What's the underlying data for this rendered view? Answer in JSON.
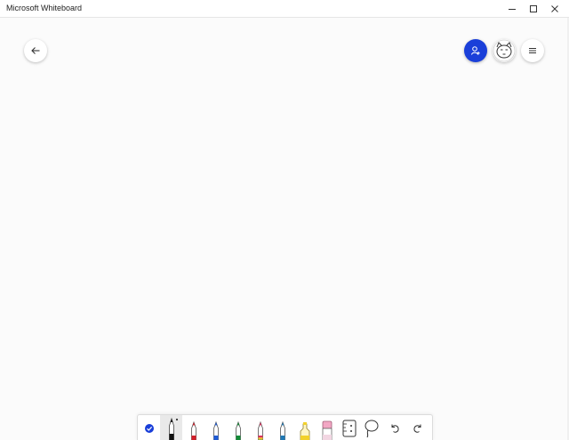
{
  "window": {
    "title": "Microsoft Whiteboard"
  },
  "colors": {
    "accent": "#1a3fd9",
    "pen_black": "#111111",
    "pen_red": "#d21f2a",
    "pen_blue": "#1e5bd6",
    "pen_green": "#138a36",
    "pen_pink": "#d9335e",
    "pen_teal": "#1f78b4",
    "highlighter_yellow": "#f2d12a",
    "eraser_pink": "#f2a7c4"
  },
  "header": {
    "back_icon": "arrow-left-icon",
    "share_icon": "person-add-icon",
    "avatar_icon": "user-avatar-icon",
    "menu_icon": "hamburger-menu-icon"
  },
  "toolbar": {
    "tools": [
      "select-check-icon",
      "pen-black-icon",
      "pen-red-icon",
      "pen-blue-icon",
      "pen-green-icon",
      "pen-rainbow-icon",
      "pen-galaxy-icon",
      "highlighter-icon",
      "eraser-icon",
      "ruler-icon",
      "lasso-icon",
      "undo-icon",
      "redo-icon"
    ],
    "selected": "pen-black-icon"
  }
}
